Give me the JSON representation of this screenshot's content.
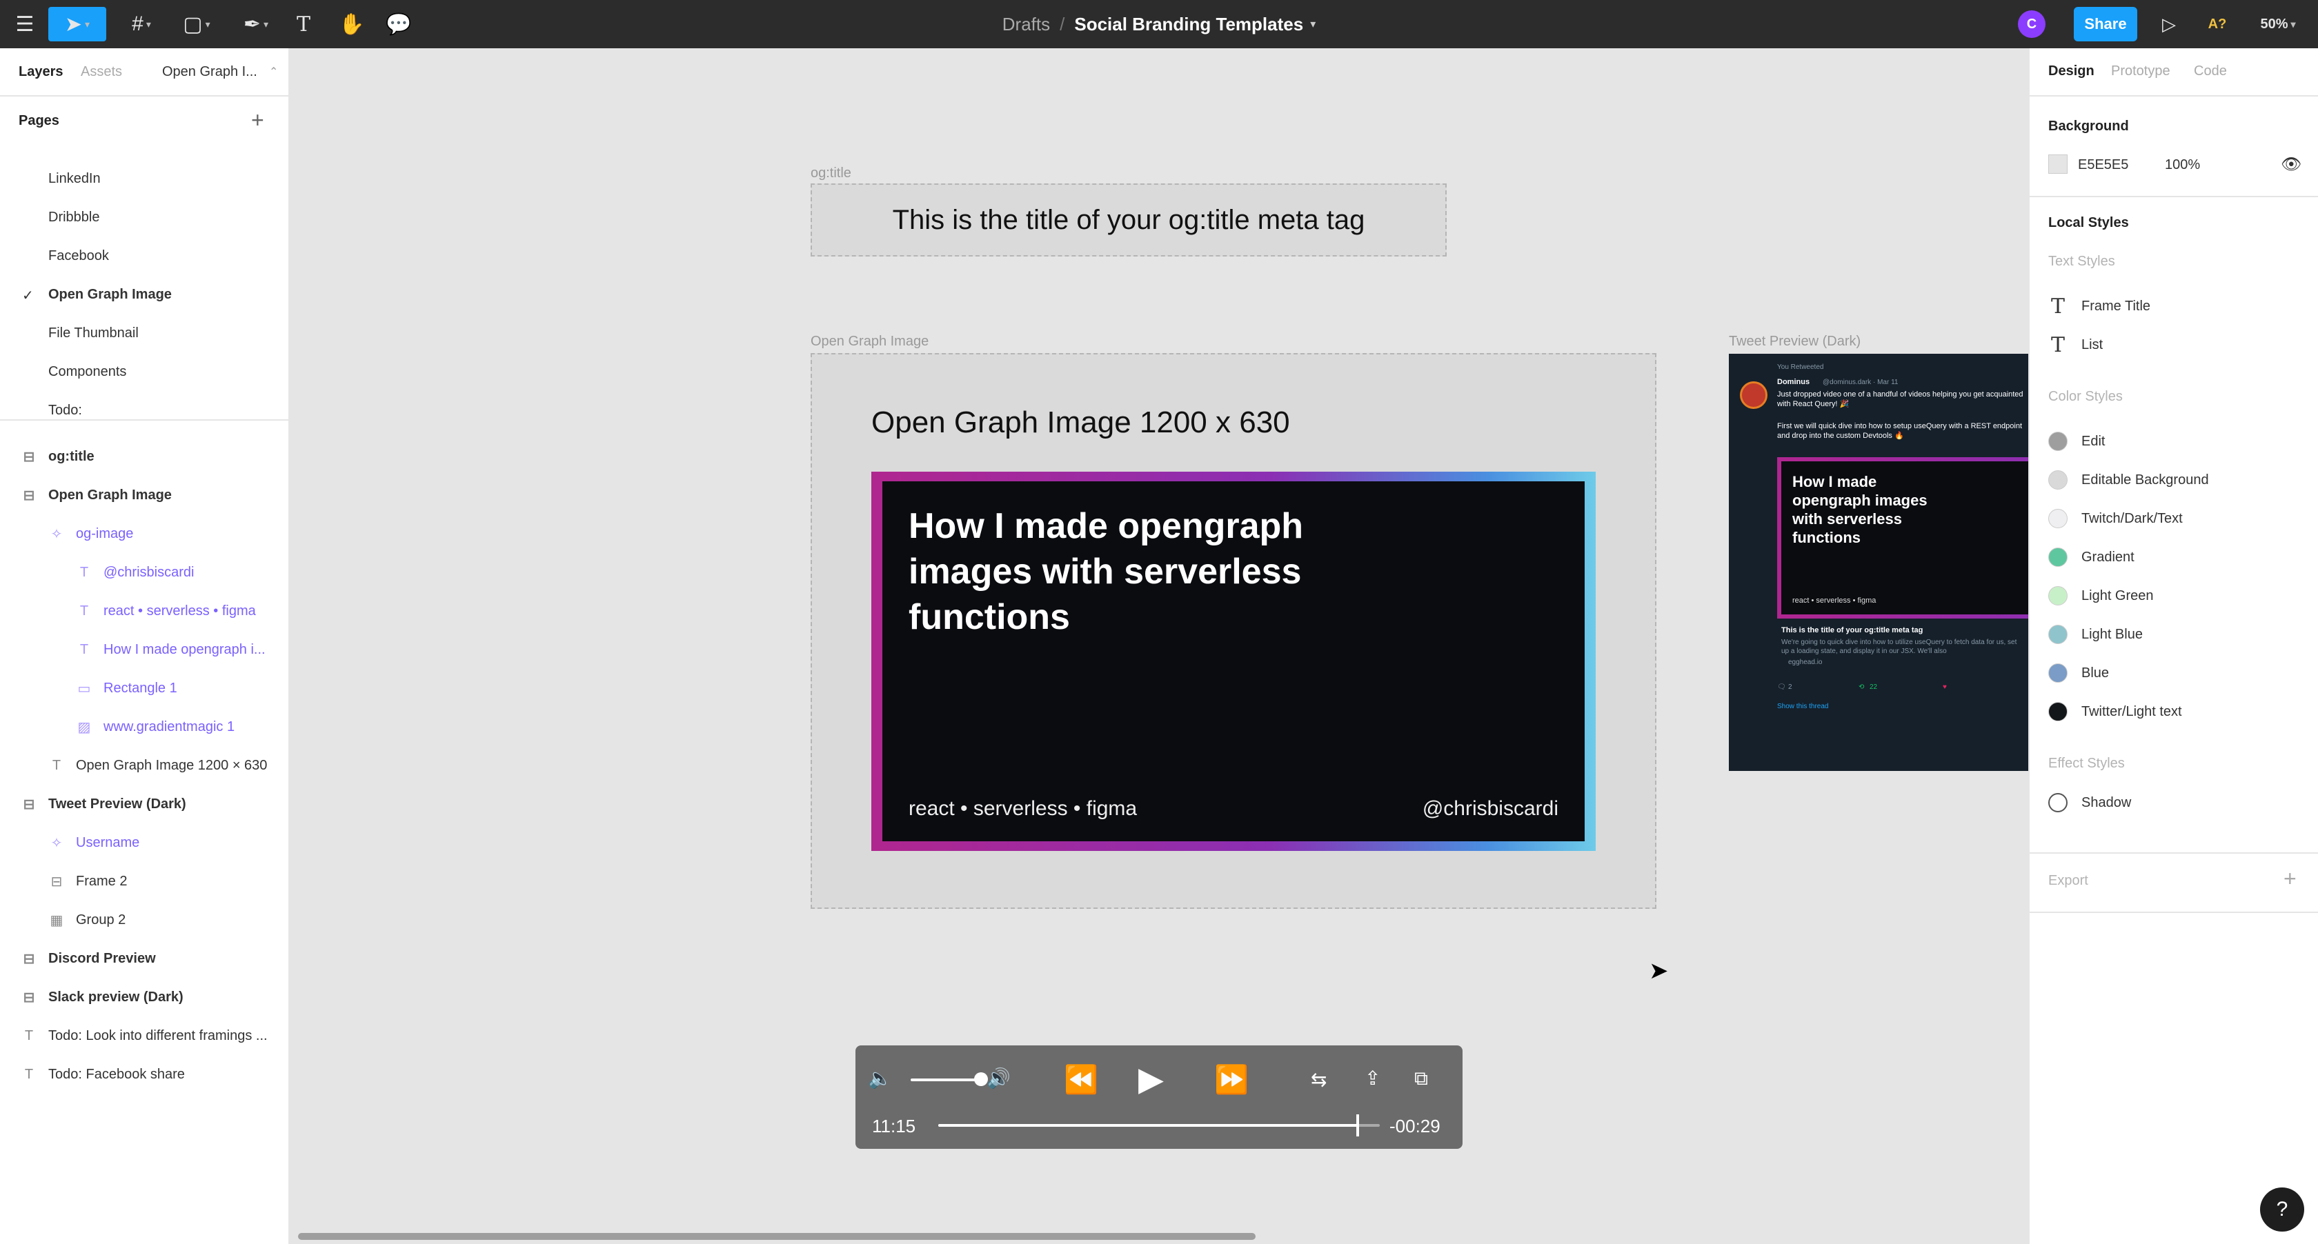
{
  "toolbar": {
    "breadcrumb_root": "Drafts",
    "breadcrumb_sep": "/",
    "file_name": "Social Branding Templates",
    "avatar_initial": "C",
    "share_label": "Share",
    "font_missing": "A?",
    "zoom": "50%"
  },
  "left_panel": {
    "tabs": [
      "Layers",
      "Assets",
      "Open Graph I..."
    ],
    "pages_title": "Pages",
    "pages": [
      "LinkedIn",
      "Dribbble",
      "Facebook",
      "Open Graph Image",
      "File Thumbnail",
      "Components",
      "Todo:"
    ],
    "current_page": "Open Graph Image",
    "layers": [
      {
        "label": "og:title",
        "icon": "frame-icon",
        "level": 0,
        "style": "bold"
      },
      {
        "label": "Open Graph Image",
        "icon": "frame-icon",
        "level": 0,
        "style": "bold"
      },
      {
        "label": "og-image",
        "icon": "component-icon",
        "level": 1,
        "style": "purple"
      },
      {
        "label": "@chrisbiscardi",
        "icon": "text-icon",
        "level": 2,
        "style": "purple"
      },
      {
        "label": "react • serverless • figma",
        "icon": "text-icon",
        "level": 2,
        "style": "purple"
      },
      {
        "label": "How I made opengraph i...",
        "icon": "text-icon",
        "level": 2,
        "style": "purple"
      },
      {
        "label": "Rectangle 1",
        "icon": "rectangle-icon",
        "level": 2,
        "style": "purple"
      },
      {
        "label": "www.gradientmagic 1",
        "icon": "image-icon",
        "level": 2,
        "style": "purple"
      },
      {
        "label": "Open Graph Image 1200 × 630",
        "icon": "text-icon",
        "level": 1,
        "style": "normal"
      },
      {
        "label": "Tweet Preview (Dark)",
        "icon": "frame-icon",
        "level": 0,
        "style": "bold"
      },
      {
        "label": "Username",
        "icon": "component-icon",
        "level": 1,
        "style": "purple"
      },
      {
        "label": "Frame 2",
        "icon": "frame-icon",
        "level": 1,
        "style": "normal"
      },
      {
        "label": "Group 2",
        "icon": "group-icon",
        "level": 1,
        "style": "normal"
      },
      {
        "label": "Discord Preview",
        "icon": "frame-icon",
        "level": 0,
        "style": "bold"
      },
      {
        "label": "Slack preview (Dark)",
        "icon": "frame-icon",
        "level": 0,
        "style": "bold"
      },
      {
        "label": "Todo: Look into different framings ...",
        "icon": "text-icon",
        "level": 0,
        "style": "normal"
      },
      {
        "label": "Todo: Facebook share",
        "icon": "text-icon",
        "level": 0,
        "style": "normal"
      }
    ]
  },
  "canvas": {
    "ogtitle_label": "og:title",
    "ogtitle_text": "This is the title of your og:title meta tag",
    "og_frame_label": "Open Graph Image",
    "og_heading": "Open Graph Image 1200 x 630",
    "og_card_title": "How I made opengraph images with serverless functions",
    "og_card_tags": "react • serverless • figma",
    "og_card_handle": "@chrisbiscardi",
    "tweet_label": "Tweet Preview (Dark)",
    "tweet": {
      "retweeted": "You Retweeted",
      "author": "Dominus",
      "author_meta": "@dominus.dark · Mar 11",
      "text1": "Just dropped video one of a handful of videos helping you get acquainted with React Query! 🎉",
      "text2": "First we will quick dive into how to setup useQuery with a REST endpoint and drop into the custom Devtools 🔥",
      "card_title": "How I made opengraph images with serverless functions",
      "card_tags": "react • serverless • figma",
      "link_title": "This is the title of your og:title meta tag",
      "link_desc": "We're going to quick dive into how to utilize useQuery to fetch data for us, set up a loading state, and display it in our JSX. We'll also",
      "link_domain": "egghead.io",
      "replies": "2",
      "retweets": "22",
      "show_thread": "Show this thread"
    }
  },
  "video_controls": {
    "elapsed": "11:15",
    "remaining": "-00:29",
    "progress": 0.95,
    "volume": 0.85
  },
  "right_panel": {
    "tabs": [
      "Design",
      "Prototype",
      "Code"
    ],
    "background_title": "Background",
    "background_hex": "E5E5E5",
    "background_opacity": "100%",
    "local_styles_title": "Local Styles",
    "text_styles_title": "Text Styles",
    "text_styles": [
      "Frame Title",
      "List"
    ],
    "color_styles_title": "Color Styles",
    "color_styles": [
      {
        "name": "Edit",
        "color": "#9e9e9e"
      },
      {
        "name": "Editable Background",
        "color": "#d9d9d9"
      },
      {
        "name": "Twitch/Dark/Text",
        "color": "#efeff1"
      },
      {
        "name": "Gradient",
        "color": "#5fc7a0"
      },
      {
        "name": "Light Green",
        "color": "#c8f0c8"
      },
      {
        "name": "Light Blue",
        "color": "#8fc4cc"
      },
      {
        "name": "Blue",
        "color": "#7a9cc6"
      },
      {
        "name": "Twitter/Light text",
        "color": "#14171a"
      }
    ],
    "effect_styles_title": "Effect Styles",
    "effect_styles": [
      "Shadow"
    ],
    "export_title": "Export"
  },
  "help_label": "?"
}
